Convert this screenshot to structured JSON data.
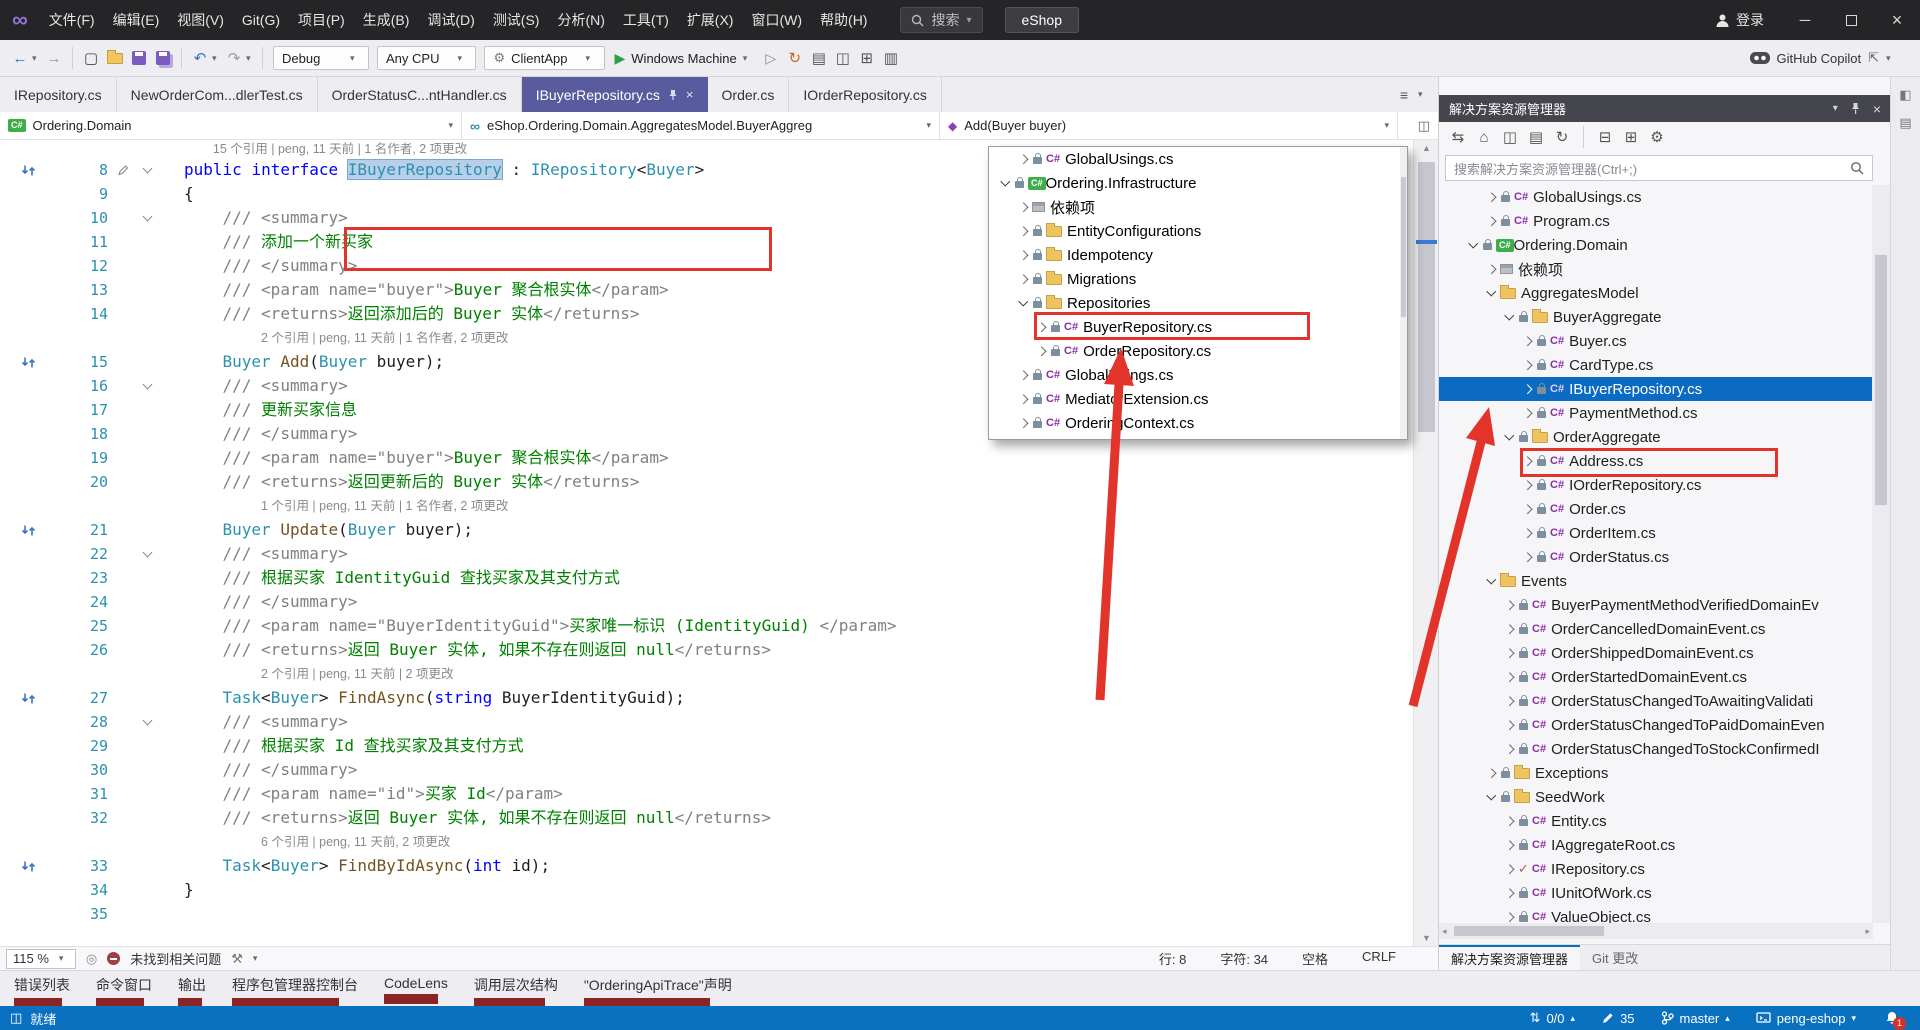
{
  "colors": {
    "titlebar_bg": "#252528",
    "toolbar_bg": "#eeeef2",
    "active_tab_bg": "#585b9d",
    "statusbar_bg": "#0a70c0",
    "selection_bg": "#0b6bc3",
    "annotation_red": "#e2342a"
  },
  "title_bar": {
    "menus": [
      "文件(F)",
      "编辑(E)",
      "视图(V)",
      "Git(G)",
      "项目(P)",
      "生成(B)",
      "调试(D)",
      "测试(S)",
      "分析(N)",
      "工具(T)",
      "扩展(X)",
      "窗口(W)",
      "帮助(H)"
    ],
    "search_label": "搜索",
    "solution_name": "eShop",
    "sign_in_label": "登录"
  },
  "toolbar": {
    "configuration": "Debug",
    "platform": "Any CPU",
    "startup_item": "ClientApp",
    "run_target": "Windows Machine",
    "copilot_label": "GitHub Copilot",
    "icons_left": [
      {
        "name": "navigate-back-icon",
        "glyph": "←",
        "color": "#3273c5"
      },
      {
        "name": "navigate-forward-icon",
        "glyph": "→",
        "color": "#9a9aa0"
      },
      {
        "name": "undo-icon",
        "glyph": "↶",
        "color": "#3273c5"
      },
      {
        "name": "redo-icon",
        "glyph": "↷",
        "color": "#9a9aa0"
      },
      {
        "name": "hot-reload-icon",
        "glyph": "↻",
        "color": "#c4651f"
      },
      {
        "name": "misc-tool-icon-1",
        "glyph": "▤",
        "color": "#555"
      },
      {
        "name": "misc-tool-icon-2",
        "glyph": "◫",
        "color": "#555"
      },
      {
        "name": "misc-tool-icon-3",
        "glyph": "⊞",
        "color": "#555"
      },
      {
        "name": "misc-tool-icon-4",
        "glyph": "▥",
        "color": "#555"
      }
    ]
  },
  "document_tabs": [
    {
      "label": "IRepository.cs",
      "active": false
    },
    {
      "label": "NewOrderCom...dlerTest.cs",
      "active": false
    },
    {
      "label": "OrderStatusC...ntHandler.cs",
      "active": false
    },
    {
      "label": "IBuyerRepository.cs",
      "active": true
    },
    {
      "label": "Order.cs",
      "active": false
    },
    {
      "label": "IOrderRepository.cs",
      "active": false
    }
  ],
  "breadcrumb": {
    "project": "Ordering.Domain",
    "type": "eShop.Ordering.Domain.AggregatesModel.BuyerAggreg",
    "member": "Add(Buyer buyer)"
  },
  "editor": {
    "lines": [
      {
        "lens": "15 个引用 | peng, 11 天前 | 1 名作者, 2 项更改",
        "ind": 3,
        "clip": 1
      },
      {
        "n": 8,
        "fold": 1,
        "ref": 1,
        "pencil": 1,
        "ind": 0,
        "seg": [
          [
            "k",
            "public "
          ],
          [
            "k",
            "interface "
          ],
          [
            "sel",
            "IBuyerRepository"
          ],
          [
            "p",
            " : "
          ],
          [
            "t",
            "IRepository"
          ],
          [
            "p",
            "<"
          ],
          [
            "t",
            "Buyer"
          ],
          [
            "p",
            ">"
          ]
        ]
      },
      {
        "n": 9,
        "ind": 0,
        "seg": [
          [
            "p",
            "{"
          ]
        ]
      },
      {
        "n": 10,
        "fold": 1,
        "ind": 1,
        "seg": [
          [
            "g",
            "/// <summary>"
          ]
        ]
      },
      {
        "n": 11,
        "ind": 1,
        "seg": [
          [
            "g",
            "/// "
          ],
          [
            "c",
            "添加一个新买家"
          ]
        ]
      },
      {
        "n": 12,
        "ind": 1,
        "seg": [
          [
            "g",
            "/// </summary>"
          ]
        ]
      },
      {
        "n": 13,
        "ind": 1,
        "seg": [
          [
            "g",
            "/// <param name=\"buyer\">"
          ],
          [
            "c",
            "Buyer 聚合根实体"
          ],
          [
            "g",
            "</param>"
          ]
        ]
      },
      {
        "n": 14,
        "ind": 1,
        "seg": [
          [
            "g",
            "/// <returns>"
          ],
          [
            "c",
            "返回添加后的 Buyer 实体"
          ],
          [
            "g",
            "</returns>"
          ]
        ]
      },
      {
        "lens": "2 个引用 | peng, 11 天前 | 1 名作者, 2 项更改",
        "ind": 8
      },
      {
        "n": 15,
        "ref": 1,
        "ind": 1,
        "seg": [
          [
            "t",
            "Buyer"
          ],
          [
            "p",
            " "
          ],
          [
            "m",
            "Add"
          ],
          [
            "p",
            "("
          ],
          [
            "t",
            "Buyer"
          ],
          [
            "p",
            " buyer);"
          ]
        ]
      },
      {
        "n": 16,
        "fold": 1,
        "ind": 1,
        "seg": [
          [
            "g",
            "/// <summary>"
          ]
        ]
      },
      {
        "n": 17,
        "ind": 1,
        "seg": [
          [
            "g",
            "/// "
          ],
          [
            "c",
            "更新买家信息"
          ]
        ]
      },
      {
        "n": 18,
        "ind": 1,
        "seg": [
          [
            "g",
            "/// </summary>"
          ]
        ]
      },
      {
        "n": 19,
        "ind": 1,
        "seg": [
          [
            "g",
            "/// <param name=\"buyer\">"
          ],
          [
            "c",
            "Buyer 聚合根实体"
          ],
          [
            "g",
            "</param>"
          ]
        ]
      },
      {
        "n": 20,
        "ind": 1,
        "seg": [
          [
            "g",
            "/// <returns>"
          ],
          [
            "c",
            "返回更新后的 Buyer 实体"
          ],
          [
            "g",
            "</returns>"
          ]
        ]
      },
      {
        "lens": "1 个引用 | peng, 11 天前 | 1 名作者, 2 项更改",
        "ind": 8
      },
      {
        "n": 21,
        "ref": 1,
        "ind": 1,
        "seg": [
          [
            "t",
            "Buyer"
          ],
          [
            "p",
            " "
          ],
          [
            "m",
            "Update"
          ],
          [
            "p",
            "("
          ],
          [
            "t",
            "Buyer"
          ],
          [
            "p",
            " buyer);"
          ]
        ]
      },
      {
        "n": 22,
        "fold": 1,
        "ind": 1,
        "seg": [
          [
            "g",
            "/// <summary>"
          ]
        ]
      },
      {
        "n": 23,
        "ind": 1,
        "seg": [
          [
            "g",
            "/// "
          ],
          [
            "c",
            "根据买家 IdentityGuid 查找买家及其支付方式"
          ]
        ]
      },
      {
        "n": 24,
        "ind": 1,
        "seg": [
          [
            "g",
            "/// </summary>"
          ]
        ]
      },
      {
        "n": 25,
        "ind": 1,
        "seg": [
          [
            "g",
            "/// <param name=\"BuyerIdentityGuid\">"
          ],
          [
            "c",
            "买家唯一标识 (IdentityGuid) "
          ],
          [
            "g",
            "</param>"
          ]
        ]
      },
      {
        "n": 26,
        "ind": 1,
        "seg": [
          [
            "g",
            "/// <returns>"
          ],
          [
            "c",
            "返回 Buyer 实体, 如果不存在则返回 null"
          ],
          [
            "g",
            "</returns>"
          ]
        ]
      },
      {
        "lens": "2 个引用 | peng, 11 天前 | 2 项更改",
        "ind": 8
      },
      {
        "n": 27,
        "ref": 1,
        "ind": 1,
        "seg": [
          [
            "t",
            "Task"
          ],
          [
            "p",
            "<"
          ],
          [
            "t",
            "Buyer"
          ],
          [
            "p",
            "> "
          ],
          [
            "m",
            "FindAsync"
          ],
          [
            "p",
            "("
          ],
          [
            "k",
            "string"
          ],
          [
            "p",
            " BuyerIdentityGuid);"
          ]
        ]
      },
      {
        "n": 28,
        "fold": 1,
        "ind": 1,
        "seg": [
          [
            "g",
            "/// <summary>"
          ]
        ]
      },
      {
        "n": 29,
        "ind": 1,
        "seg": [
          [
            "g",
            "/// "
          ],
          [
            "c",
            "根据买家 Id 查找买家及其支付方式"
          ]
        ]
      },
      {
        "n": 30,
        "ind": 1,
        "seg": [
          [
            "g",
            "/// </summary>"
          ]
        ]
      },
      {
        "n": 31,
        "ind": 1,
        "seg": [
          [
            "g",
            "/// <param name=\"id\">"
          ],
          [
            "c",
            "买家 Id"
          ],
          [
            "g",
            "</param>"
          ]
        ]
      },
      {
        "n": 32,
        "ind": 1,
        "seg": [
          [
            "g",
            "/// <returns>"
          ],
          [
            "c",
            "返回 Buyer 实体, 如果不存在则返回 null"
          ],
          [
            "g",
            "</returns>"
          ]
        ]
      },
      {
        "lens": "6 个引用 | peng, 11 天前, 2 项更改",
        "ind": 8
      },
      {
        "n": 33,
        "ref": 1,
        "ind": 1,
        "seg": [
          [
            "t",
            "Task"
          ],
          [
            "p",
            "<"
          ],
          [
            "t",
            "Buyer"
          ],
          [
            "p",
            "> "
          ],
          [
            "m",
            "FindByIdAsync"
          ],
          [
            "p",
            "("
          ],
          [
            "k",
            "int"
          ],
          [
            "p",
            " id);"
          ]
        ]
      },
      {
        "n": 34,
        "ind": 0,
        "seg": [
          [
            "p",
            "}"
          ]
        ]
      },
      {
        "n": 35,
        "ind": 0,
        "seg": []
      }
    ],
    "status": {
      "zoom": "115 %",
      "no_issues": "未找到相关问题",
      "line": "行: 8",
      "column": "字符: 34",
      "spaces": "空格",
      "eol": "CRLF"
    }
  },
  "popup": {
    "items": [
      {
        "indent": 1,
        "chev": "r",
        "lock": 1,
        "icon": "cs",
        "label": "GlobalUsings.cs"
      },
      {
        "indent": 0,
        "chev": "d",
        "lock": 1,
        "icon": "csproj",
        "label": "Ordering.Infrastructure"
      },
      {
        "indent": 1,
        "chev": "r",
        "icon": "deps",
        "label": "依赖项"
      },
      {
        "indent": 1,
        "chev": "r",
        "lock": 1,
        "icon": "folder",
        "label": "EntityConfigurations"
      },
      {
        "indent": 1,
        "chev": "r",
        "lock": 1,
        "icon": "folder",
        "label": "Idempotency"
      },
      {
        "indent": 1,
        "chev": "r",
        "lock": 1,
        "icon": "folder",
        "label": "Migrations"
      },
      {
        "indent": 1,
        "chev": "d",
        "lock": 1,
        "icon": "folder",
        "label": "Repositories"
      },
      {
        "indent": 2,
        "chev": "r",
        "lock": 1,
        "icon": "cs",
        "label": "BuyerRepository.cs"
      },
      {
        "indent": 2,
        "chev": "r",
        "lock": 1,
        "icon": "cs",
        "label": "OrderRepository.cs"
      },
      {
        "indent": 1,
        "chev": "r",
        "lock": 1,
        "icon": "cs",
        "label": "GlobalUsings.cs"
      },
      {
        "indent": 1,
        "chev": "r",
        "lock": 1,
        "icon": "cs",
        "label": "MediatorExtension.cs"
      },
      {
        "indent": 1,
        "chev": "r",
        "lock": 1,
        "icon": "cs",
        "label": "OrderingContext.cs"
      }
    ]
  },
  "solution_explorer": {
    "title": "解决方案资源管理器",
    "search_placeholder": "搜索解决方案资源管理器(Ctrl+;)",
    "toolbar_icons": [
      {
        "name": "sync-with-active-document-icon",
        "glyph": "⇆"
      },
      {
        "name": "home-icon",
        "glyph": "⌂"
      },
      {
        "name": "switch-views-icon",
        "glyph": "◫"
      },
      {
        "name": "show-all-files-icon",
        "glyph": "▤"
      },
      {
        "name": "refresh-icon",
        "glyph": "↻"
      },
      {
        "name": "collapse-all-icon",
        "glyph": "⊟"
      },
      {
        "name": "expand-icon",
        "glyph": "⊞"
      },
      {
        "name": "settings-icon",
        "glyph": "⚙"
      }
    ],
    "items": [
      {
        "indent": 2,
        "chev": "r",
        "lock": 1,
        "icon": "cs",
        "label": "GlobalUsings.cs"
      },
      {
        "indent": 2,
        "chev": "r",
        "lock": 1,
        "icon": "cs",
        "label": "Program.cs"
      },
      {
        "indent": 1,
        "chev": "d",
        "lock": 1,
        "icon": "csproj",
        "label": "Ordering.Domain"
      },
      {
        "indent": 2,
        "chev": "r",
        "icon": "deps",
        "label": "依赖项"
      },
      {
        "indent": 2,
        "chev": "d",
        "icon": "folder",
        "label": "AggregatesModel"
      },
      {
        "indent": 3,
        "chev": "d",
        "lock": 1,
        "icon": "folder",
        "label": "BuyerAggregate"
      },
      {
        "indent": 4,
        "chev": "r",
        "lock": 1,
        "icon": "cs",
        "label": "Buyer.cs"
      },
      {
        "indent": 4,
        "chev": "r",
        "lock": 1,
        "icon": "cs",
        "label": "CardType.cs"
      },
      {
        "indent": 4,
        "chev": "r",
        "lock": 1,
        "icon": "cs",
        "label": "IBuyerRepository.cs",
        "selected": 1
      },
      {
        "indent": 4,
        "chev": "r",
        "lock": 1,
        "icon": "cs",
        "label": "PaymentMethod.cs"
      },
      {
        "indent": 3,
        "chev": "d",
        "lock": 1,
        "icon": "folder",
        "label": "OrderAggregate"
      },
      {
        "indent": 4,
        "chev": "r",
        "lock": 1,
        "icon": "cs",
        "label": "Address.cs"
      },
      {
        "indent": 4,
        "chev": "r",
        "lock": 1,
        "icon": "cs",
        "label": "IOrderRepository.cs"
      },
      {
        "indent": 4,
        "chev": "r",
        "lock": 1,
        "icon": "cs",
        "label": "Order.cs"
      },
      {
        "indent": 4,
        "chev": "r",
        "lock": 1,
        "icon": "cs",
        "label": "OrderItem.cs"
      },
      {
        "indent": 4,
        "chev": "r",
        "lock": 1,
        "icon": "cs",
        "label": "OrderStatus.cs"
      },
      {
        "indent": 2,
        "chev": "d",
        "icon": "folder",
        "label": "Events"
      },
      {
        "indent": 3,
        "chev": "r",
        "lock": 1,
        "icon": "cs",
        "label": "BuyerPaymentMethodVerifiedDomainEv"
      },
      {
        "indent": 3,
        "chev": "r",
        "lock": 1,
        "icon": "cs",
        "label": "OrderCancelledDomainEvent.cs"
      },
      {
        "indent": 3,
        "chev": "r",
        "lock": 1,
        "icon": "cs",
        "label": "OrderShippedDomainEvent.cs"
      },
      {
        "indent": 3,
        "chev": "r",
        "lock": 1,
        "icon": "cs",
        "label": "OrderStartedDomainEvent.cs"
      },
      {
        "indent": 3,
        "chev": "r",
        "lock": 1,
        "icon": "cs",
        "label": "OrderStatusChangedToAwaitingValidati"
      },
      {
        "indent": 3,
        "chev": "r",
        "lock": 1,
        "icon": "cs",
        "label": "OrderStatusChangedToPaidDomainEven"
      },
      {
        "indent": 3,
        "chev": "r",
        "lock": 1,
        "icon": "cs",
        "label": "OrderStatusChangedToStockConfirmedI"
      },
      {
        "indent": 2,
        "chev": "r",
        "lock": 1,
        "icon": "folder",
        "label": "Exceptions"
      },
      {
        "indent": 2,
        "chev": "d",
        "lock": 1,
        "icon": "folder",
        "label": "SeedWork"
      },
      {
        "indent": 3,
        "chev": "r",
        "lock": 1,
        "icon": "cs",
        "label": "Entity.cs"
      },
      {
        "indent": 3,
        "chev": "r",
        "lock": 1,
        "icon": "cs",
        "label": "IAggregateRoot.cs"
      },
      {
        "indent": 3,
        "chev": "r",
        "status": "edited",
        "icon": "cs",
        "label": "IRepository.cs"
      },
      {
        "indent": 3,
        "chev": "r",
        "lock": 1,
        "icon": "cs",
        "label": "IUnitOfWork.cs"
      },
      {
        "indent": 3,
        "chev": "r",
        "lock": 1,
        "icon": "cs",
        "label": "ValueObject.cs"
      }
    ],
    "bottom_tabs": [
      {
        "label": "解决方案资源管理器",
        "active": true
      },
      {
        "label": "Git 更改",
        "active": false
      }
    ]
  },
  "panel_tabs": [
    "错误列表",
    "命令窗口",
    "输出",
    "程序包管理器控制台",
    "CodeLens",
    "调用层次结构",
    "\"OrderingApiTrace\"声明"
  ],
  "status_bar": {
    "ready": "就绪",
    "sync_count": "0/0",
    "pending_edits": "35",
    "branch": "master",
    "repo": "peng-eshop",
    "notification_count": "1"
  }
}
